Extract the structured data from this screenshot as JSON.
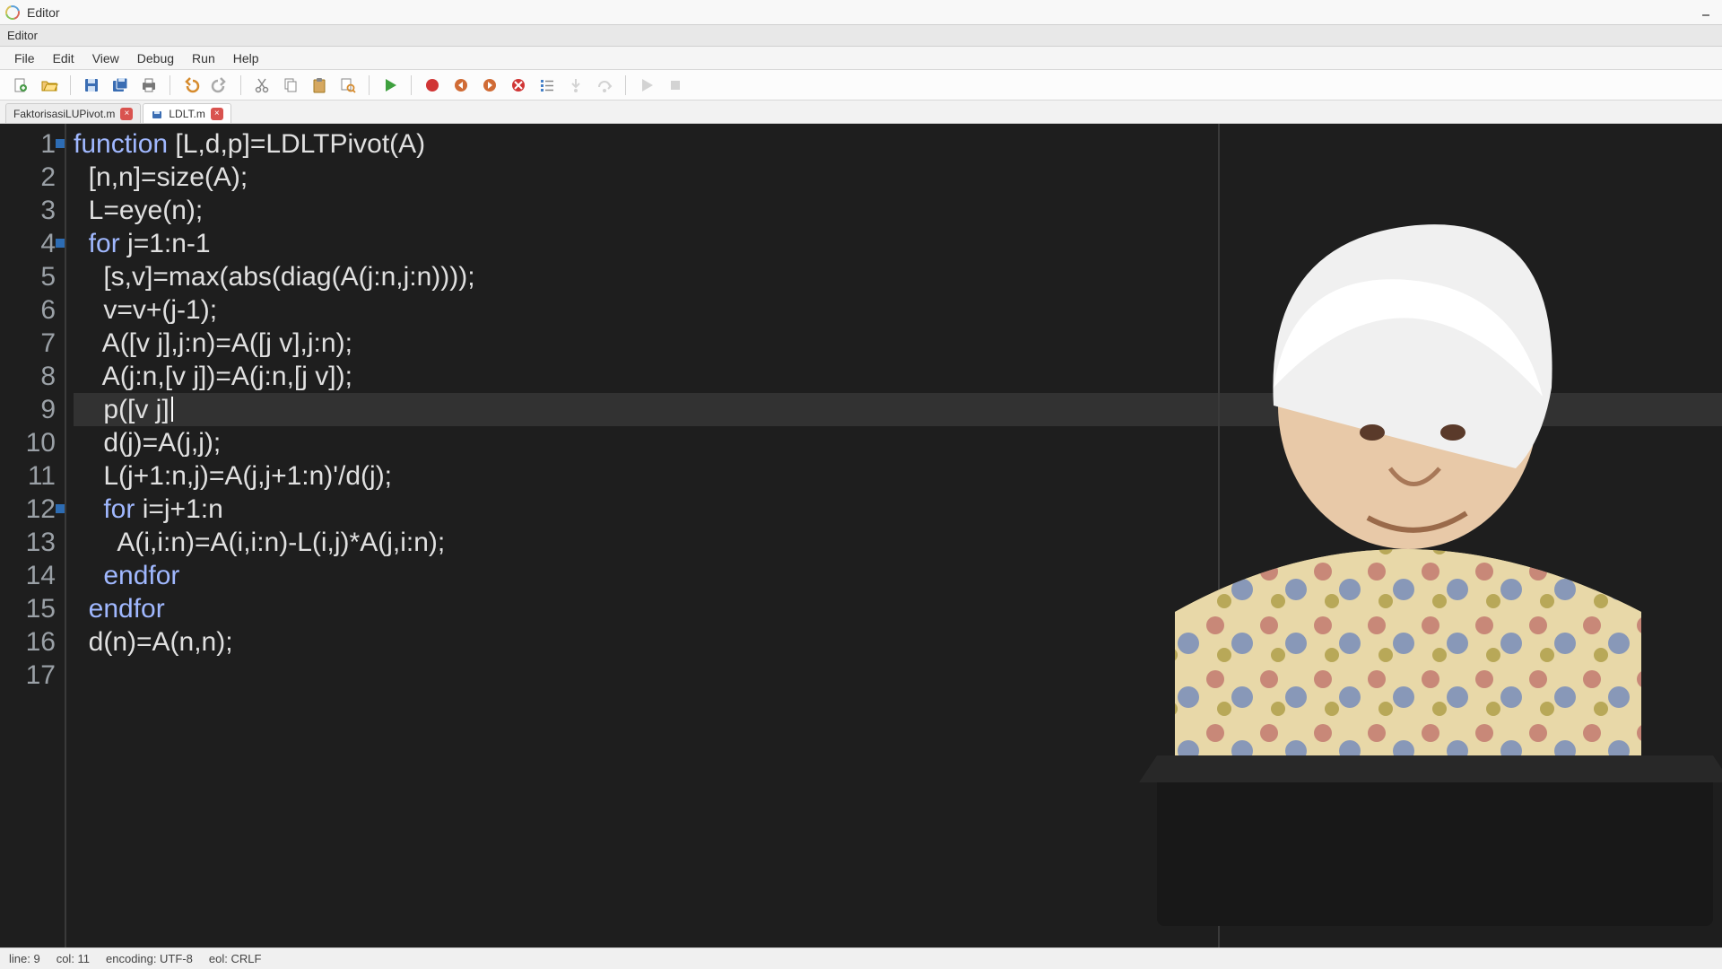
{
  "window": {
    "title": "Editor"
  },
  "subheader": {
    "text": "Editor",
    "watermark": ""
  },
  "menu": {
    "file": "File",
    "edit": "Edit",
    "view": "View",
    "debug": "Debug",
    "run": "Run",
    "help": "Help"
  },
  "toolbar": {
    "new": "new-file",
    "open": "open",
    "save": "save",
    "saveall": "save-all",
    "print": "print",
    "undo": "undo",
    "redo": "redo",
    "cut": "cut",
    "copy": "copy",
    "paste": "paste",
    "find": "find",
    "run": "run",
    "record": "record",
    "stepback": "step-back",
    "stepforward": "step-forward",
    "stop": "stop",
    "breakpoints": "breakpoints",
    "stepinto": "step-into",
    "stepover": "step-over",
    "continue": "continue",
    "halt": "halt"
  },
  "tabs": [
    {
      "label": "FaktorisasiLUPivot.m",
      "active": false
    },
    {
      "label": "LDLT.m",
      "active": true
    }
  ],
  "code": {
    "lines": [
      {
        "n": 1,
        "fold": true,
        "tokens": [
          {
            "t": "function ",
            "c": "kw"
          },
          {
            "t": "[L,d,p]=LDLTPivot(A)",
            "c": "txt"
          }
        ]
      },
      {
        "n": 2,
        "tokens": [
          {
            "t": "  [n,n]=size(A);",
            "c": "txt"
          }
        ]
      },
      {
        "n": 3,
        "tokens": [
          {
            "t": "  L=eye(n);",
            "c": "txt"
          }
        ]
      },
      {
        "n": 4,
        "fold": true,
        "tokens": [
          {
            "t": "  ",
            "c": "txt"
          },
          {
            "t": "for ",
            "c": "kw"
          },
          {
            "t": "j=1:n-1",
            "c": "txt"
          }
        ]
      },
      {
        "n": 5,
        "tokens": [
          {
            "t": "    [s,v]=max(abs(diag(A(j:n,j:n))));",
            "c": "txt"
          }
        ]
      },
      {
        "n": 6,
        "tokens": [
          {
            "t": "    v=v+(j-1);",
            "c": "txt"
          }
        ]
      },
      {
        "n": 7,
        "tokens": [
          {
            "t": "    A([v j],j:n)=A([j v],j:n);",
            "c": "txt"
          }
        ]
      },
      {
        "n": 8,
        "tokens": [
          {
            "t": "    A(j:n,[v j])=A(j:n,[j v]);",
            "c": "txt"
          }
        ]
      },
      {
        "n": 9,
        "hl": true,
        "caret": true,
        "tokens": [
          {
            "t": "    p([v j]",
            "c": "txt"
          }
        ]
      },
      {
        "n": 10,
        "tokens": [
          {
            "t": "    d(j)=A(j,j);",
            "c": "txt"
          }
        ]
      },
      {
        "n": 11,
        "tokens": [
          {
            "t": "    L(j+1:n,j)=A(j,j+1:n)'/d(j);",
            "c": "txt"
          }
        ]
      },
      {
        "n": 12,
        "fold": true,
        "tokens": [
          {
            "t": "    ",
            "c": "txt"
          },
          {
            "t": "for ",
            "c": "kw"
          },
          {
            "t": "i=j+1:n",
            "c": "txt"
          }
        ]
      },
      {
        "n": 13,
        "tokens": [
          {
            "t": "      A(i,i:n)=A(i,i:n)-L(i,j)*A(j,i:n);",
            "c": "txt"
          }
        ]
      },
      {
        "n": 14,
        "tokens": [
          {
            "t": "    ",
            "c": "txt"
          },
          {
            "t": "endfor",
            "c": "kw"
          }
        ]
      },
      {
        "n": 15,
        "tokens": [
          {
            "t": "  ",
            "c": "txt"
          },
          {
            "t": "endfor",
            "c": "kw"
          }
        ]
      },
      {
        "n": 16,
        "tokens": [
          {
            "t": "  d(n)=A(n,n);",
            "c": "txt"
          }
        ]
      },
      {
        "n": 17,
        "tokens": [
          {
            "t": "",
            "c": "txt"
          }
        ]
      }
    ]
  },
  "status": {
    "line": "line: 9",
    "col": "col: 11",
    "enc": "encoding: UTF-8",
    "eol": "eol: CRLF"
  }
}
